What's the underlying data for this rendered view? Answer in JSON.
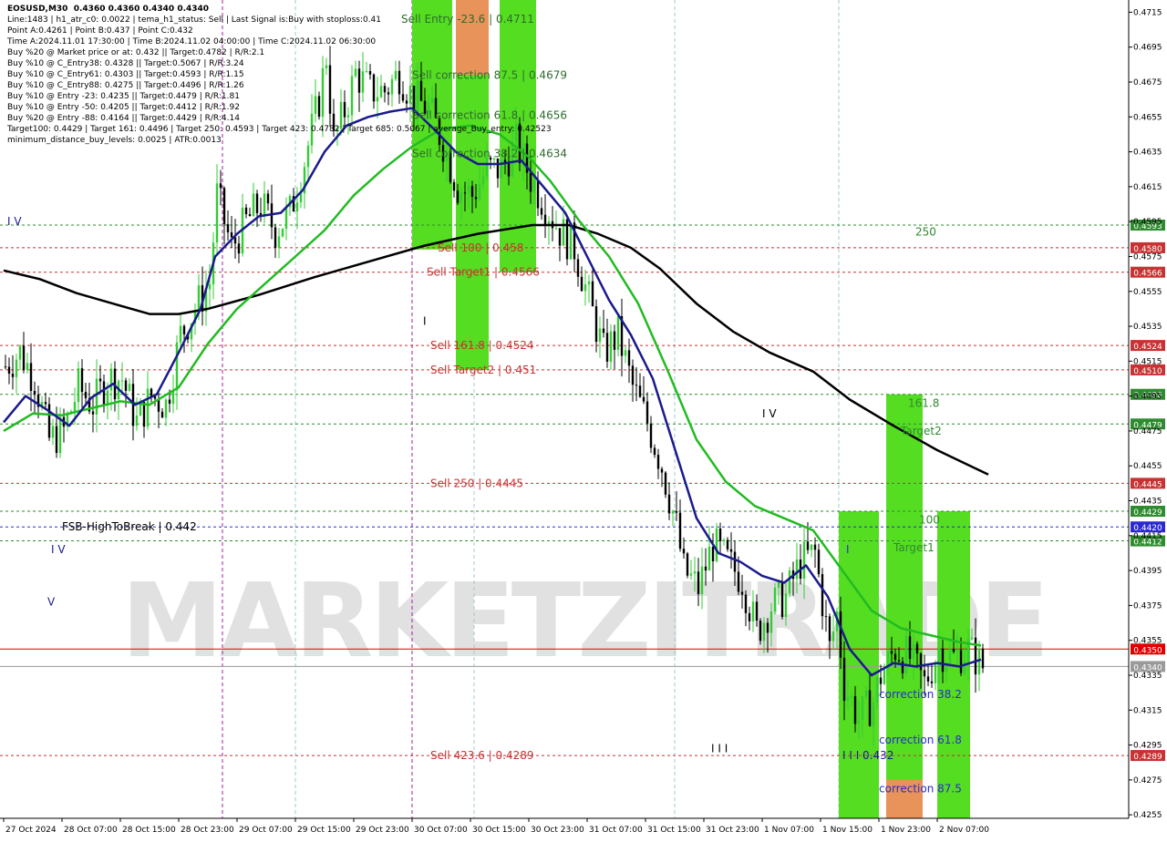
{
  "chart_data": {
    "type": "candlestick",
    "title": "EOSUSD,M30",
    "ohlc_header": "0.4360 0.4360 0.4340 0.4340",
    "info_lines": [
      "Line:1483 | h1_atr_c0: 0.0022 | tema_h1_status: Sell | Last Signal is:Buy with stoploss:0.41",
      "Point A:0.4261 | Point B:0.437 | Point C:0.432",
      "Time A:2024.11.01 17:30:00 | Time B:2024.11.02 04:00:00 | Time C:2024.11.02 06:30:00",
      "Buy %20 @ Market price or at: 0.432 || Target:0.4782 | R/R:2.1",
      "Buy %10 @ C_Entry38: 0.4328 || Target:0.5067 | R/R:3.24",
      "Buy %10 @ C_Entry61: 0.4303 || Target:0.4593 | R/R:1.15",
      "Buy %10 @ C_Entry88: 0.4275 || Target:0.4496 | R/R:1.26",
      "Buy %10 @ Entry -23: 0.4235 || Target:0.4479 | R/R:1.81",
      "Buy %10 @ Entry -50: 0.4205 || Target:0.4412 | R/R:1.92",
      "Buy %20 @ Entry -88: 0.4164 || Target:0.4429 | R/R:4.14",
      "Target100: 0.4429 | Target 161: 0.4496 | Target 250: 0.4593 | Target 423: 0.4782 | Target 685: 0.5067 | average_Buy_entry: 0.42523",
      "minimum_distance_buy_levels: 0.0025 | ATR:0.0013"
    ],
    "ylim": [
      0.4253,
      0.4722
    ],
    "y_ticks": [
      "0.4715",
      "0.4695",
      "0.4675",
      "0.4655",
      "0.4635",
      "0.4615",
      "0.4595",
      "0.4575",
      "0.4555",
      "0.4535",
      "0.4515",
      "0.4495",
      "0.4475",
      "0.4455",
      "0.4435",
      "0.4415",
      "0.4395",
      "0.4375",
      "0.4355",
      "0.4335",
      "0.4315",
      "0.4295",
      "0.4275",
      "0.4255"
    ],
    "x_ticks": [
      {
        "label": "27 Oct 2024",
        "bar": 0
      },
      {
        "label": "28 Oct 07:00",
        "bar": 16
      },
      {
        "label": "28 Oct 15:00",
        "bar": 32
      },
      {
        "label": "28 Oct 23:00",
        "bar": 48
      },
      {
        "label": "29 Oct 07:00",
        "bar": 64
      },
      {
        "label": "29 Oct 15:00",
        "bar": 80
      },
      {
        "label": "29 Oct 23:00",
        "bar": 96
      },
      {
        "label": "30 Oct 07:00",
        "bar": 112
      },
      {
        "label": "30 Oct 15:00",
        "bar": 128
      },
      {
        "label": "30 Oct 23:00",
        "bar": 144
      },
      {
        "label": "31 Oct 07:00",
        "bar": 160
      },
      {
        "label": "31 Oct 15:00",
        "bar": 176
      },
      {
        "label": "31 Oct 23:00",
        "bar": 192
      },
      {
        "label": "1 Nov 07:00",
        "bar": 208
      },
      {
        "label": "1 Nov 15:00",
        "bar": 224
      },
      {
        "label": "1 Nov 23:00",
        "bar": 240
      },
      {
        "label": "2 Nov 07:00",
        "bar": 256
      }
    ],
    "close_path": [
      [
        0,
        0.4512
      ],
      [
        4,
        0.452
      ],
      [
        8,
        0.4505
      ],
      [
        12,
        0.447
      ],
      [
        16,
        0.4475
      ],
      [
        20,
        0.45
      ],
      [
        24,
        0.449
      ],
      [
        28,
        0.4505
      ],
      [
        32,
        0.4505
      ],
      [
        36,
        0.448
      ],
      [
        40,
        0.4495
      ],
      [
        44,
        0.449
      ],
      [
        48,
        0.453
      ],
      [
        52,
        0.4545
      ],
      [
        56,
        0.456
      ],
      [
        58,
        0.461
      ],
      [
        62,
        0.458
      ],
      [
        66,
        0.4595
      ],
      [
        70,
        0.4605
      ],
      [
        74,
        0.459
      ],
      [
        78,
        0.46
      ],
      [
        82,
        0.463
      ],
      [
        86,
        0.4665
      ],
      [
        88,
        0.469
      ],
      [
        90,
        0.464
      ],
      [
        94,
        0.4665
      ],
      [
        96,
        0.468
      ],
      [
        100,
        0.467
      ],
      [
        104,
        0.467
      ],
      [
        108,
        0.468
      ],
      [
        112,
        0.4665
      ],
      [
        116,
        0.466
      ],
      [
        120,
        0.464
      ],
      [
        124,
        0.4615
      ],
      [
        128,
        0.461
      ],
      [
        132,
        0.4625
      ],
      [
        136,
        0.4625
      ],
      [
        140,
        0.464
      ],
      [
        144,
        0.462
      ],
      [
        148,
        0.4605
      ],
      [
        152,
        0.459
      ],
      [
        156,
        0.458
      ],
      [
        160,
        0.455
      ],
      [
        164,
        0.452
      ],
      [
        168,
        0.453
      ],
      [
        172,
        0.45
      ],
      [
        176,
        0.448
      ],
      [
        180,
        0.4455
      ],
      [
        184,
        0.442
      ],
      [
        186,
        0.4395
      ],
      [
        190,
        0.4385
      ],
      [
        194,
        0.441
      ],
      [
        198,
        0.44
      ],
      [
        202,
        0.439
      ],
      [
        206,
        0.436
      ],
      [
        210,
        0.4375
      ],
      [
        214,
        0.438
      ],
      [
        218,
        0.44
      ],
      [
        222,
        0.4405
      ],
      [
        226,
        0.435
      ],
      [
        228,
        0.437
      ],
      [
        230,
        0.433
      ],
      [
        234,
        0.431
      ],
      [
        238,
        0.432
      ],
      [
        240,
        0.4335
      ],
      [
        244,
        0.435
      ],
      [
        248,
        0.4345
      ],
      [
        252,
        0.433
      ],
      [
        256,
        0.435
      ],
      [
        260,
        0.4345
      ],
      [
        264,
        0.435
      ],
      [
        268,
        0.434
      ]
    ],
    "series": [
      {
        "color": "#000000",
        "points": [
          [
            0,
            0.4567
          ],
          [
            10,
            0.4562
          ],
          [
            20,
            0.4554
          ],
          [
            30,
            0.4548
          ],
          [
            40,
            0.4542
          ],
          [
            48,
            0.4542
          ],
          [
            56,
            0.4545
          ],
          [
            70,
            0.4553
          ],
          [
            85,
            0.4563
          ],
          [
            100,
            0.4572
          ],
          [
            115,
            0.4581
          ],
          [
            130,
            0.4588
          ],
          [
            145,
            0.4593
          ],
          [
            155,
            0.4593
          ],
          [
            163,
            0.4588
          ],
          [
            172,
            0.458
          ],
          [
            180,
            0.4568
          ],
          [
            190,
            0.4548
          ],
          [
            200,
            0.4532
          ],
          [
            210,
            0.452
          ],
          [
            222,
            0.4509
          ],
          [
            232,
            0.4493
          ],
          [
            244,
            0.4478
          ],
          [
            256,
            0.4464
          ],
          [
            270,
            0.445
          ]
        ]
      },
      {
        "color": "#22bb22",
        "points": [
          [
            0,
            0.4475
          ],
          [
            8,
            0.4485
          ],
          [
            16,
            0.4484
          ],
          [
            24,
            0.4488
          ],
          [
            32,
            0.4492
          ],
          [
            40,
            0.449
          ],
          [
            48,
            0.45
          ],
          [
            56,
            0.4525
          ],
          [
            64,
            0.4545
          ],
          [
            72,
            0.456
          ],
          [
            80,
            0.4575
          ],
          [
            88,
            0.459
          ],
          [
            96,
            0.461
          ],
          [
            104,
            0.4625
          ],
          [
            112,
            0.4638
          ],
          [
            120,
            0.4648
          ],
          [
            128,
            0.465
          ],
          [
            136,
            0.4645
          ],
          [
            144,
            0.4632
          ],
          [
            150,
            0.4618
          ],
          [
            158,
            0.4595
          ],
          [
            166,
            0.4575
          ],
          [
            174,
            0.4548
          ],
          [
            182,
            0.451
          ],
          [
            190,
            0.447
          ],
          [
            198,
            0.4446
          ],
          [
            206,
            0.4432
          ],
          [
            214,
            0.4425
          ],
          [
            222,
            0.4418
          ],
          [
            230,
            0.4395
          ],
          [
            238,
            0.4372
          ],
          [
            246,
            0.4362
          ],
          [
            254,
            0.4358
          ],
          [
            262,
            0.4354
          ],
          [
            268,
            0.4352
          ]
        ]
      },
      {
        "color": "#1a1a8c",
        "points": [
          [
            0,
            0.448
          ],
          [
            6,
            0.4495
          ],
          [
            12,
            0.4487
          ],
          [
            18,
            0.4478
          ],
          [
            24,
            0.4494
          ],
          [
            30,
            0.4502
          ],
          [
            36,
            0.449
          ],
          [
            42,
            0.4496
          ],
          [
            48,
            0.452
          ],
          [
            54,
            0.4545
          ],
          [
            58,
            0.4575
          ],
          [
            64,
            0.4588
          ],
          [
            70,
            0.4598
          ],
          [
            76,
            0.46
          ],
          [
            82,
            0.4613
          ],
          [
            88,
            0.4635
          ],
          [
            94,
            0.465
          ],
          [
            100,
            0.4655
          ],
          [
            106,
            0.4658
          ],
          [
            112,
            0.466
          ],
          [
            118,
            0.4648
          ],
          [
            124,
            0.4635
          ],
          [
            130,
            0.4628
          ],
          [
            136,
            0.4628
          ],
          [
            142,
            0.463
          ],
          [
            148,
            0.4615
          ],
          [
            154,
            0.46
          ],
          [
            160,
            0.4575
          ],
          [
            166,
            0.455
          ],
          [
            172,
            0.453
          ],
          [
            178,
            0.4505
          ],
          [
            184,
            0.4465
          ],
          [
            190,
            0.4425
          ],
          [
            196,
            0.4405
          ],
          [
            202,
            0.44
          ],
          [
            208,
            0.4392
          ],
          [
            214,
            0.4388
          ],
          [
            220,
            0.4398
          ],
          [
            226,
            0.438
          ],
          [
            232,
            0.435
          ],
          [
            238,
            0.4335
          ],
          [
            244,
            0.4342
          ],
          [
            250,
            0.434
          ],
          [
            256,
            0.4342
          ],
          [
            262,
            0.434
          ],
          [
            268,
            0.4344
          ]
        ]
      }
    ],
    "h_levels": [
      {
        "value": 0.4593,
        "color": "#2e8b2e",
        "style": "dash",
        "badge": "0.4593"
      },
      {
        "value": 0.458,
        "color": "#c83232",
        "style": "dash",
        "badge": "0.4580"
      },
      {
        "value": 0.4566,
        "color": "#c83232",
        "style": "dash",
        "badge": "0.4566"
      },
      {
        "value": 0.4524,
        "color": "#c83232",
        "style": "dash",
        "badge": "0.4524"
      },
      {
        "value": 0.451,
        "color": "#c83232",
        "style": "dash",
        "badge": "0.4510"
      },
      {
        "value": 0.4496,
        "color": "#2e8b2e",
        "style": "dash",
        "badge": "0.4496"
      },
      {
        "value": 0.4479,
        "color": "#2e8b2e",
        "style": "dash",
        "badge": "0.4479"
      },
      {
        "value": 0.4445,
        "color": "#c83232",
        "style": "dash",
        "badge": "0.4445"
      },
      {
        "value": 0.4429,
        "color": "#2e8b2e",
        "style": "dash",
        "badge": "0.4429"
      },
      {
        "value": 0.442,
        "color": "#2a2ad0",
        "style": "dash",
        "badge": "0.4420"
      },
      {
        "value": 0.4412,
        "color": "#2e8b2e",
        "style": "dash",
        "badge": "0.4412"
      },
      {
        "value": 0.435,
        "color": "#e00000",
        "style": "solid",
        "badge": "0.4350"
      },
      {
        "value": 0.434,
        "color": "#9a9a9a",
        "style": "solid",
        "badge": "0.4340"
      },
      {
        "value": 0.4289,
        "color": "#c83232",
        "style": "dash",
        "badge": "0.4289"
      }
    ],
    "zones": [
      {
        "x0": 112,
        "x1": 123,
        "y0": 0.4579,
        "y1": 0.4722,
        "color": "#55dd22"
      },
      {
        "x0": 124,
        "x1": 133,
        "y0": 0.451,
        "y1": 0.4722,
        "color": "#55dd22"
      },
      {
        "x0": 124,
        "x1": 133,
        "y0": 0.4679,
        "y1": 0.4722,
        "color": "#e8935a"
      },
      {
        "x0": 136,
        "x1": 146,
        "y0": 0.4566,
        "y1": 0.4722,
        "color": "#55dd22"
      },
      {
        "x0": 229,
        "x1": 240,
        "y0": 0.4253,
        "y1": 0.4429,
        "color": "#55dd22"
      },
      {
        "x0": 242,
        "x1": 252,
        "y0": 0.4253,
        "y1": 0.4496,
        "color": "#55dd22"
      },
      {
        "x0": 242,
        "x1": 252,
        "y0": 0.4253,
        "y1": 0.4275,
        "color": "#e8935a"
      },
      {
        "x0": 256,
        "x1": 265,
        "y0": 0.4253,
        "y1": 0.4429,
        "color": "#55dd22"
      }
    ],
    "annotations": [
      {
        "text": "Sell Entry -23.6 | 0.4711",
        "bar": 109,
        "y": 0.4711,
        "color": "#2e6b2e"
      },
      {
        "text": "Sell correction 87.5 | 0.4679",
        "bar": 112,
        "y": 0.4679,
        "color": "#2e6b2e"
      },
      {
        "text": "Sell correction 61.8 | 0.4656",
        "bar": 112,
        "y": 0.4656,
        "color": "#2e6b2e"
      },
      {
        "text": "Sell correction 38.2 | 0.4634",
        "bar": 112,
        "y": 0.4634,
        "color": "#2e6b2e"
      },
      {
        "text": "Sell 100 | 0.458",
        "bar": 119,
        "y": 0.458,
        "color": "#c83232"
      },
      {
        "text": "Sell Target1 | 0.4566",
        "bar": 116,
        "y": 0.4566,
        "color": "#c83232"
      },
      {
        "text": "Sell 161.8 | 0.4524",
        "bar": 117,
        "y": 0.4524,
        "color": "#c83232"
      },
      {
        "text": "Sell Target2 | 0.451",
        "bar": 117,
        "y": 0.451,
        "color": "#c83232"
      },
      {
        "text": "Sell 250 | 0.4445",
        "bar": 117,
        "y": 0.4445,
        "color": "#c83232"
      },
      {
        "text": "Sell 423.6 | 0.4289",
        "bar": 117,
        "y": 0.4289,
        "color": "#c83232"
      },
      {
        "text": "250",
        "bar": 250,
        "y": 0.4589,
        "color": "#2e8b2e"
      },
      {
        "text": "161.8",
        "bar": 248,
        "y": 0.4491,
        "color": "#2e8b2e"
      },
      {
        "text": "Target2",
        "bar": 246,
        "y": 0.4475,
        "color": "#2e8b2e"
      },
      {
        "text": "100",
        "bar": 251,
        "y": 0.4424,
        "color": "#2e8b2e"
      },
      {
        "text": "Target1",
        "bar": 244,
        "y": 0.4408,
        "color": "#2e8b2e"
      },
      {
        "text": "correction 38.2",
        "bar": 240,
        "y": 0.4324,
        "color": "#2a2ad0"
      },
      {
        "text": "correction 61.8",
        "bar": 240,
        "y": 0.4298,
        "color": "#2a2ad0"
      },
      {
        "text": "correction 87.5",
        "bar": 240,
        "y": 0.427,
        "color": "#2a2ad0"
      },
      {
        "text": "FSB-HighToBreak | 0.442",
        "bar": 16,
        "y": 0.442,
        "color": "#000000"
      },
      {
        "text": "I I I 0.432",
        "bar": 230,
        "y": 0.4289,
        "color": "#1a1a8c"
      },
      {
        "text": "I V",
        "bar": 1,
        "y": 0.4595,
        "color": "#1a1a8c"
      },
      {
        "text": "I V",
        "bar": 13,
        "y": 0.4407,
        "color": "#1a1a8c"
      },
      {
        "text": "V",
        "bar": 12,
        "y": 0.4377,
        "color": "#1a1a8c"
      },
      {
        "text": "I",
        "bar": 115,
        "y": 0.4538,
        "color": "#000000"
      },
      {
        "text": "I V",
        "bar": 208,
        "y": 0.4485,
        "color": "#000000"
      },
      {
        "text": "I I I",
        "bar": 194,
        "y": 0.4293,
        "color": "#000000"
      },
      {
        "text": "I",
        "bar": 231,
        "y": 0.4407,
        "color": "#2a2ad0"
      }
    ],
    "watermark": "MARKETZITRADE"
  }
}
